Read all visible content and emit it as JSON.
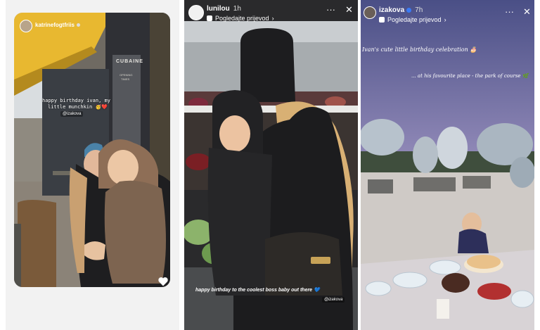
{
  "stories": [
    {
      "username": "katrinefogtfriis",
      "caption_line1": "happy birthday ivan, my",
      "caption_line2": "little munchkin",
      "caption_emoji": "🥳❤️",
      "mention": "@izakova",
      "shop_sign": "CUBAINE",
      "shop_sub1": "OPENING",
      "shop_sub2": "TIMES"
    },
    {
      "username": "lunilou",
      "time": "1h",
      "view_link": "Pogledajte prijevod",
      "caption": "happy birthday to the coolest boss baby out there 💙",
      "mention": "@izakova"
    },
    {
      "username": "izakova",
      "time": "7h",
      "view_link": "Pogledajte prijevod",
      "caption_line1": "Ivan's cute little birthday celebration 🎂",
      "caption_line2": "... at his favourite place - the park of course 🌿"
    }
  ],
  "icons": {
    "more": "more-icon",
    "close": "close-icon",
    "heart": "heart-icon",
    "verified": "verified-badge-icon",
    "chevron": "chevron-right-icon"
  },
  "colors": {
    "awning": "#e8b830",
    "hat_blue": "#4a82a8",
    "sky": "#8d86b5",
    "balloon": "#b7c2cc"
  }
}
